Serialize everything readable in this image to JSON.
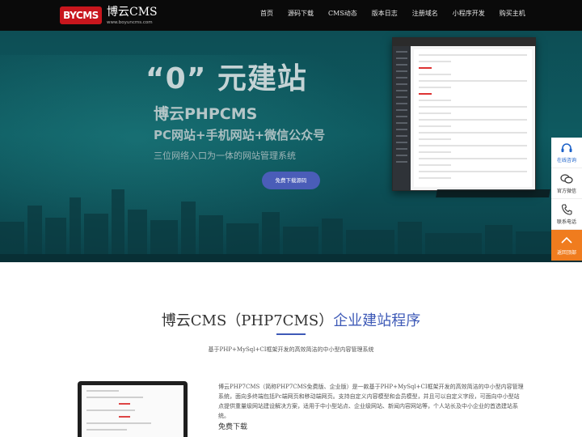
{
  "header": {
    "logo_badge": "BYCMS",
    "logo_name": "博云CMS",
    "logo_url": "www.boyuncms.com",
    "nav": [
      "首页",
      "源码下载",
      "CMS动态",
      "版本日志",
      "注册域名",
      "小程序开发",
      "购买主机"
    ]
  },
  "hero": {
    "headline": "“0” 元建站",
    "brand": "博云PHPCMS",
    "line2": "PC网站+手机网站+微信公众号",
    "line3": "三位网络入口为一体的网站管理系统",
    "button": "免费下载源码"
  },
  "float_panel": {
    "items": [
      {
        "label": "在线咨询",
        "icon": "headset-icon"
      },
      {
        "label": "官方微信",
        "icon": "wechat-icon"
      },
      {
        "label": "联系电话",
        "icon": "phone-icon"
      },
      {
        "label": "返回顶部",
        "icon": "arrow-up-icon"
      }
    ]
  },
  "main": {
    "title_left": "博云CMS（PHP7CMS）",
    "title_accent": "企业建站程序",
    "subtitle": "基于PHP+MySql+CI框架开发的高效简洁的中小型内容管理系统",
    "description": "博云PHP7CMS（简称PHP7CMS免费版、企业版）是一款基于PHP+MySql+CI框架开发的高效简洁的中小型内容管理系统，面向多终端包括Pc端网页和移动端网页。支持自定义内容模型和会员模型，并且可以自定义字段，可面向中小型站点提供重量级网站建设解决方案，适用于中小型站点、企业级网站、新闻内容网站等，个人站长及中小企业的首选建站系统。",
    "download_title": "免费下载"
  },
  "colors": {
    "accent": "#3e5ab7",
    "header_bg": "#0a0a0a",
    "hero_bg": "#0e5a60",
    "back_to_top": "#f07c1e"
  }
}
